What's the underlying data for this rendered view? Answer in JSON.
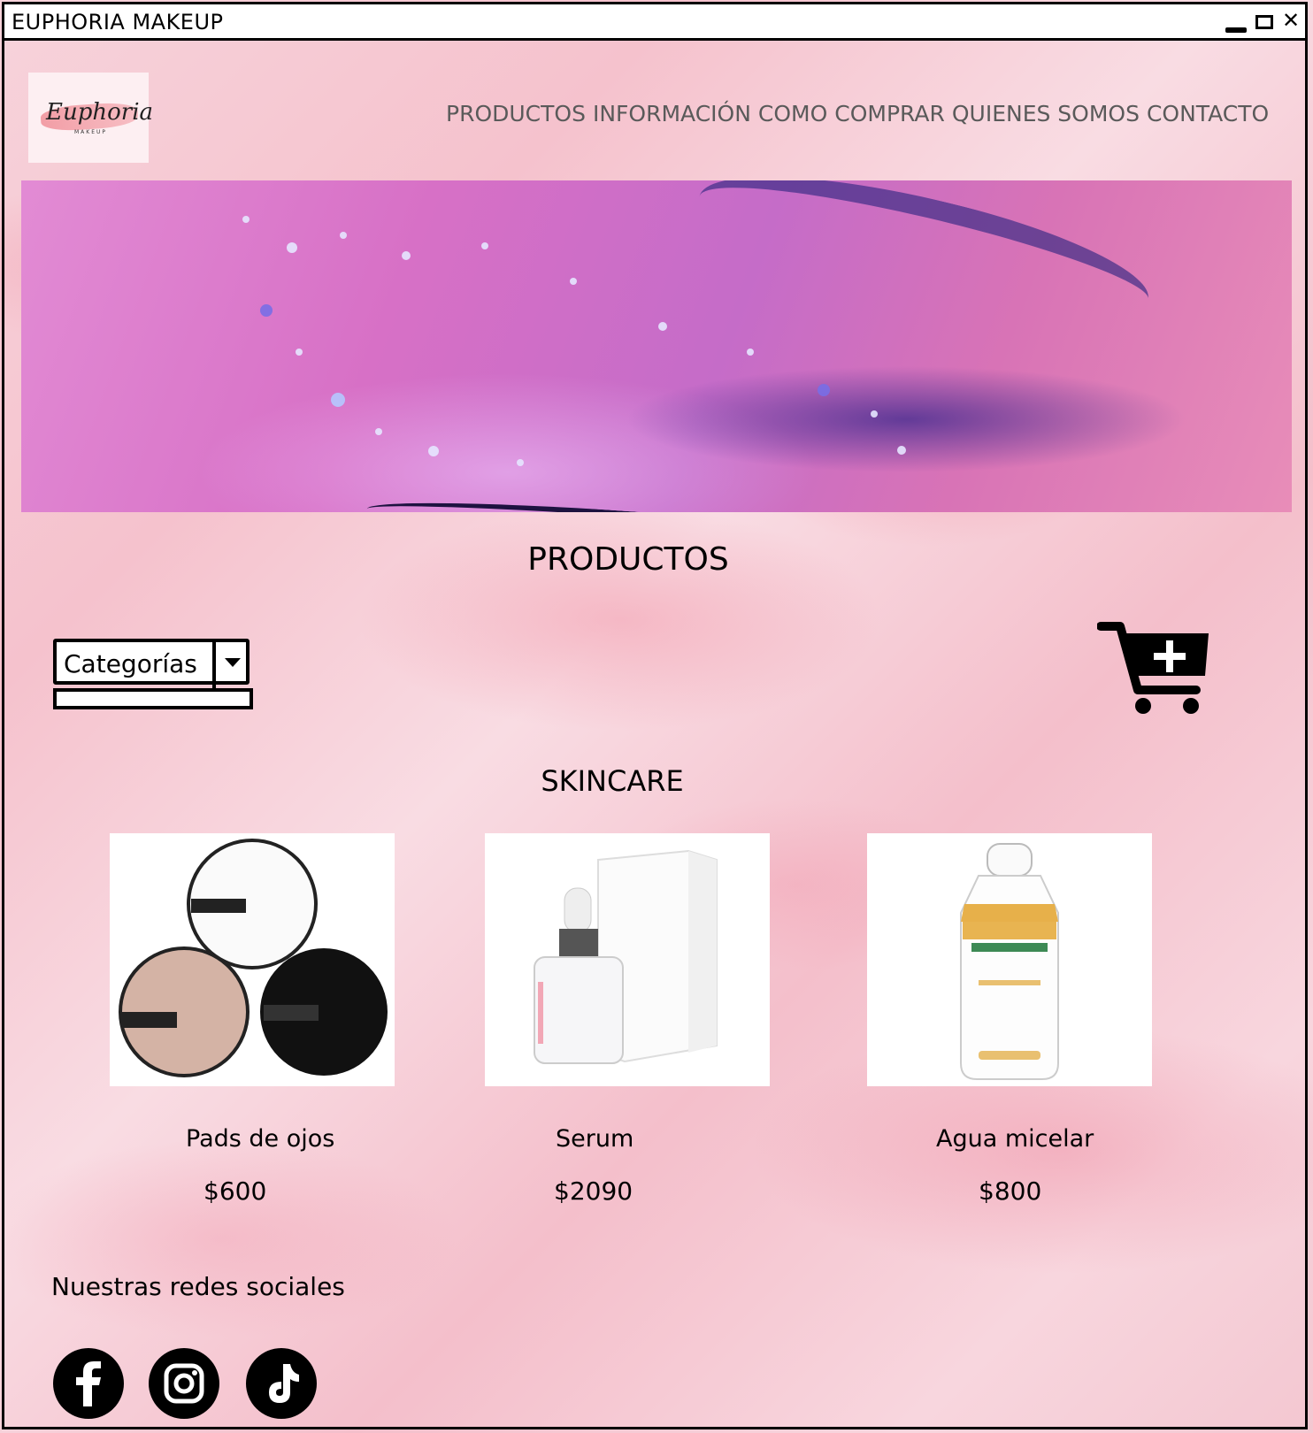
{
  "window": {
    "title": "EUPHORIA MAKEUP"
  },
  "logo": {
    "script_text": "Euphoria",
    "sub_text": "MAKEUP"
  },
  "nav": {
    "items": [
      "PRODUCTOS",
      "INFORMACIÓN",
      "COMO COMPRAR",
      "QUIENES SOMOS",
      "CONTACTO"
    ]
  },
  "main": {
    "section_title": "PRODUCTOS",
    "category_select": {
      "label": "Categorías"
    },
    "category_title": "SKINCARE",
    "products": [
      {
        "name": "Pads de ojos",
        "price": "$600"
      },
      {
        "name": "Serum",
        "price": "$2090"
      },
      {
        "name": "Agua micelar",
        "price": "$800"
      }
    ]
  },
  "footer": {
    "social_title": "Nuestras redes sociales",
    "social_icons": [
      "facebook-icon",
      "instagram-icon",
      "tiktok-icon"
    ]
  },
  "colors": {
    "nav_text": "#5a5a5a",
    "background": "#f7d3db",
    "brush_accent": "#f08f98"
  }
}
